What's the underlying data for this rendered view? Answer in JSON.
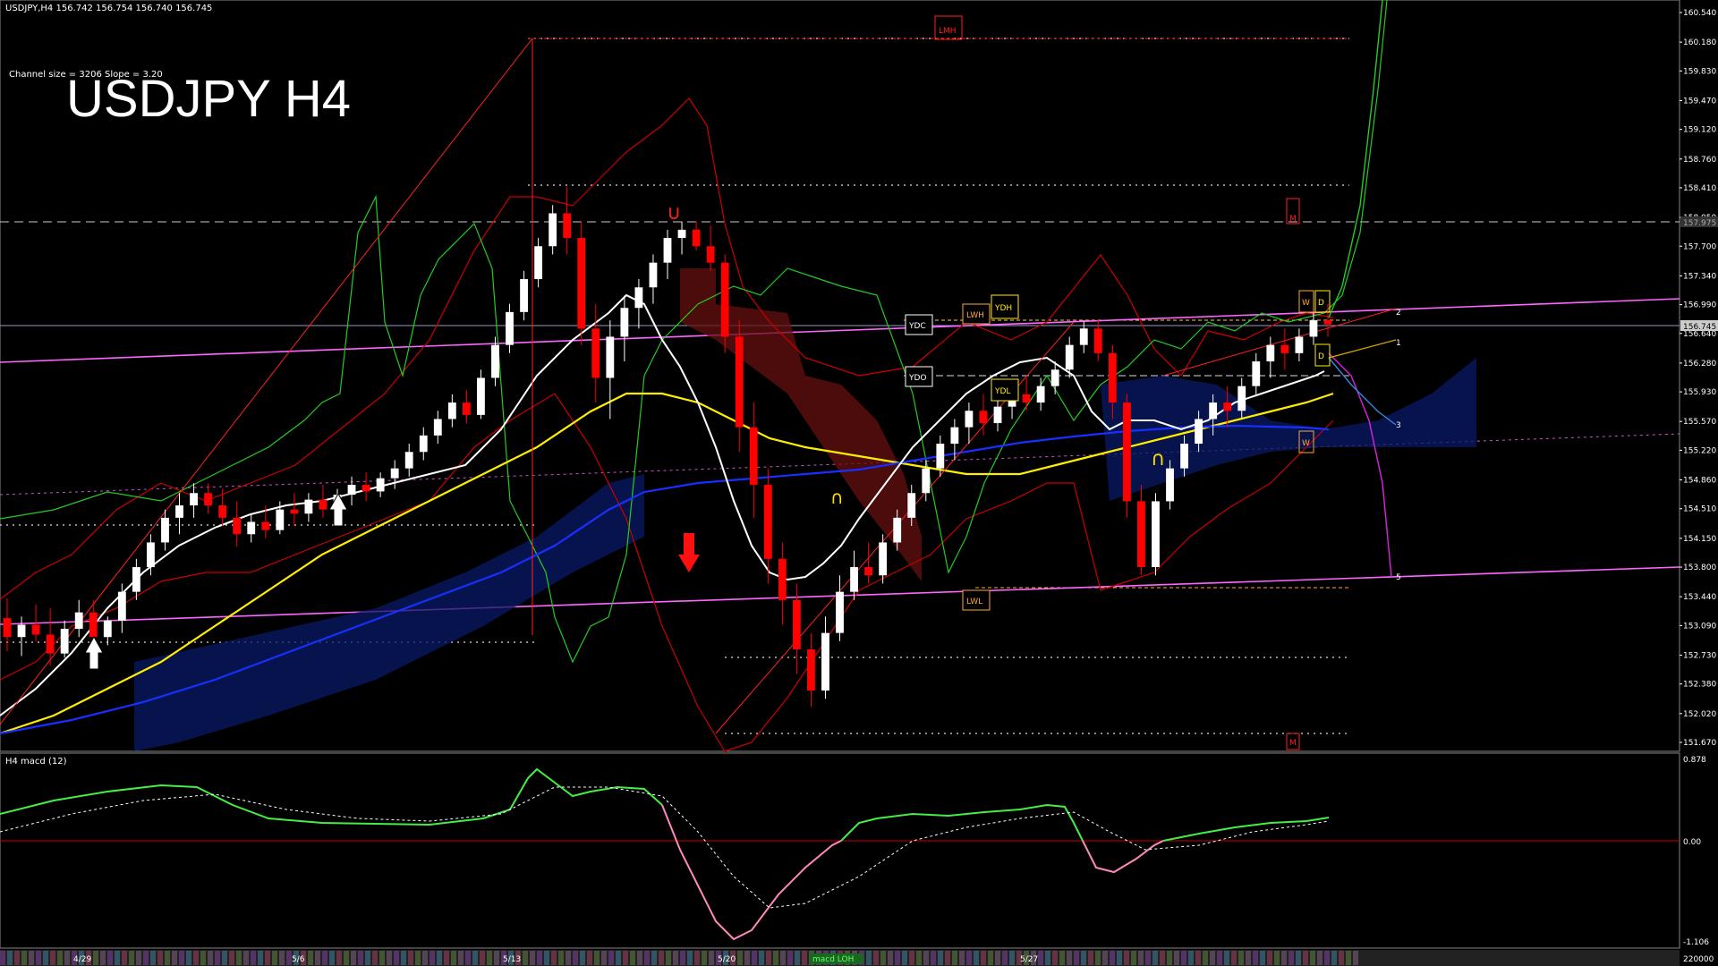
{
  "header": {
    "symbol_line": "USDJPY,H4  156.742 156.754 156.740 156.745",
    "channel_info": "Channel size = 3206 Slope = 3.20",
    "title": "USDJPY H4"
  },
  "macd": {
    "label": "H4  macd (12)",
    "axis_labels": [
      "0.878",
      "0.00",
      "-1.106"
    ],
    "bottom_value": "220000"
  },
  "price_axis": {
    "labels": [
      "160.540",
      "160.180",
      "159.830",
      "159.470",
      "159.120",
      "158.760",
      "158.410",
      "158.050",
      "157.700",
      "157.340",
      "156.990",
      "156.640",
      "156.280",
      "155.930",
      "155.570",
      "155.220",
      "154.860",
      "154.510",
      "154.150",
      "153.800",
      "153.440",
      "153.090",
      "152.730",
      "152.380",
      "152.020",
      "151.670"
    ],
    "current_price": "156.745",
    "upper_marker": "157.975"
  },
  "date_axis": {
    "labels": [
      "4/29",
      "5/6",
      "5/13",
      "5/20",
      "5/27"
    ],
    "scroll_label": "macd LOH"
  },
  "chart_tags": {
    "lmh": "LMH",
    "m_top": "M",
    "m_bottom": "M",
    "ydc": "YDC",
    "ydo": "YDO",
    "ydh": "YDH",
    "ydl": "YDL",
    "lwh": "LWH",
    "lwl": "LWL",
    "w_top": "W",
    "d_top": "D",
    "d_mid": "D",
    "w_low": "W"
  },
  "projection_labels": [
    "2",
    "1",
    "3",
    "5"
  ],
  "colors": {
    "background": "#000000",
    "bull_candle": "#ffffff",
    "bear_candle": "#ff0000",
    "ma_white": "#ffffff",
    "ma_yellow": "#ffee00",
    "ma_blue": "#1830ff",
    "bollinger": "#cc0000",
    "channel": "#ff66ff",
    "green_line": "#22cc22",
    "macd_green": "#44ee44",
    "macd_pink": "#ff88bb"
  },
  "chart_data": {
    "type": "candlestick",
    "ylim": [
      151.67,
      160.54
    ],
    "current_price": 156.745,
    "candles": [
      [
        153.18,
        153.42,
        152.78,
        152.95
      ],
      [
        152.95,
        153.2,
        152.72,
        153.1
      ],
      [
        153.1,
        153.35,
        152.9,
        152.98
      ],
      [
        152.98,
        153.3,
        152.6,
        152.75
      ],
      [
        152.75,
        153.15,
        152.7,
        153.05
      ],
      [
        153.05,
        153.4,
        152.95,
        153.25
      ],
      [
        153.25,
        153.4,
        152.85,
        152.95
      ],
      [
        152.95,
        153.2,
        152.85,
        153.15
      ],
      [
        153.15,
        153.6,
        153.0,
        153.5
      ],
      [
        153.5,
        153.9,
        153.4,
        153.8
      ],
      [
        153.8,
        154.2,
        153.7,
        154.1
      ],
      [
        154.1,
        154.5,
        154.0,
        154.4
      ],
      [
        154.4,
        154.7,
        154.2,
        154.55
      ],
      [
        154.55,
        154.82,
        154.4,
        154.7
      ],
      [
        154.7,
        154.82,
        154.45,
        154.55
      ],
      [
        154.55,
        154.75,
        154.3,
        154.4
      ],
      [
        154.4,
        154.6,
        154.05,
        154.2
      ],
      [
        154.2,
        154.45,
        154.1,
        154.35
      ],
      [
        154.35,
        154.55,
        154.15,
        154.25
      ],
      [
        154.25,
        154.6,
        154.2,
        154.5
      ],
      [
        154.5,
        154.7,
        154.3,
        154.45
      ],
      [
        154.45,
        154.7,
        154.35,
        154.62
      ],
      [
        154.62,
        154.8,
        154.4,
        154.5
      ],
      [
        154.5,
        154.75,
        154.4,
        154.68
      ],
      [
        154.68,
        154.9,
        154.55,
        154.8
      ],
      [
        154.8,
        154.95,
        154.6,
        154.72
      ],
      [
        154.72,
        154.95,
        154.65,
        154.88
      ],
      [
        154.88,
        155.1,
        154.75,
        155.0
      ],
      [
        155.0,
        155.3,
        154.9,
        155.2
      ],
      [
        155.2,
        155.5,
        155.1,
        155.4
      ],
      [
        155.4,
        155.7,
        155.3,
        155.6
      ],
      [
        155.6,
        155.9,
        155.5,
        155.8
      ],
      [
        155.8,
        155.95,
        155.55,
        155.65
      ],
      [
        155.65,
        156.2,
        155.6,
        156.1
      ],
      [
        156.1,
        156.6,
        156.0,
        156.5
      ],
      [
        156.5,
        157.0,
        156.4,
        156.9
      ],
      [
        156.9,
        157.4,
        156.8,
        157.3
      ],
      [
        157.3,
        157.8,
        157.2,
        157.7
      ],
      [
        157.7,
        158.2,
        157.6,
        158.1
      ],
      [
        158.1,
        158.42,
        157.6,
        157.8
      ],
      [
        157.8,
        158.0,
        156.5,
        156.7
      ],
      [
        156.7,
        157.0,
        155.8,
        156.1
      ],
      [
        156.1,
        156.8,
        155.6,
        156.6
      ],
      [
        156.6,
        157.1,
        156.3,
        156.95
      ],
      [
        156.95,
        157.3,
        156.7,
        157.2
      ],
      [
        157.2,
        157.6,
        157.0,
        157.5
      ],
      [
        157.5,
        157.9,
        157.3,
        157.8
      ],
      [
        157.8,
        158.0,
        157.6,
        157.9
      ],
      [
        157.9,
        158.0,
        157.65,
        157.7
      ],
      [
        157.7,
        157.95,
        157.4,
        157.5
      ],
      [
        157.5,
        157.6,
        156.4,
        156.6
      ],
      [
        156.6,
        156.8,
        155.2,
        155.5
      ],
      [
        155.5,
        155.8,
        154.4,
        154.8
      ],
      [
        154.8,
        155.0,
        153.6,
        153.9
      ],
      [
        153.9,
        154.1,
        153.1,
        153.4
      ],
      [
        153.4,
        153.6,
        152.5,
        152.8
      ],
      [
        152.8,
        153.0,
        152.1,
        152.3
      ],
      [
        152.3,
        153.2,
        152.2,
        153.0
      ],
      [
        153.0,
        153.7,
        152.9,
        153.5
      ],
      [
        153.5,
        154.0,
        153.4,
        153.8
      ],
      [
        153.8,
        154.1,
        153.6,
        153.7
      ],
      [
        153.7,
        154.2,
        153.6,
        154.1
      ],
      [
        154.1,
        154.5,
        154.0,
        154.4
      ],
      [
        154.4,
        154.8,
        154.3,
        154.7
      ],
      [
        154.7,
        155.1,
        154.6,
        155.0
      ],
      [
        155.0,
        155.4,
        154.9,
        155.3
      ],
      [
        155.3,
        155.6,
        155.1,
        155.5
      ],
      [
        155.5,
        155.8,
        155.3,
        155.7
      ],
      [
        155.7,
        155.9,
        155.4,
        155.55
      ],
      [
        155.55,
        155.85,
        155.45,
        155.75
      ],
      [
        155.75,
        156.0,
        155.6,
        155.9
      ],
      [
        155.9,
        156.1,
        155.7,
        155.8
      ],
      [
        155.8,
        156.1,
        155.7,
        156.0
      ],
      [
        156.0,
        156.3,
        155.9,
        156.2
      ],
      [
        156.2,
        156.6,
        156.1,
        156.5
      ],
      [
        156.5,
        156.8,
        156.4,
        156.7
      ],
      [
        156.7,
        156.8,
        156.3,
        156.4
      ],
      [
        156.4,
        156.5,
        155.6,
        155.8
      ],
      [
        155.8,
        155.9,
        154.4,
        154.6
      ],
      [
        154.6,
        154.8,
        153.7,
        153.8
      ],
      [
        153.8,
        154.7,
        153.7,
        154.6
      ],
      [
        154.6,
        155.1,
        154.5,
        155.0
      ],
      [
        155.0,
        155.4,
        154.9,
        155.3
      ],
      [
        155.3,
        155.7,
        155.2,
        155.6
      ],
      [
        155.6,
        155.9,
        155.4,
        155.8
      ],
      [
        155.8,
        156.0,
        155.5,
        155.7
      ],
      [
        155.7,
        156.1,
        155.6,
        156.0
      ],
      [
        156.0,
        156.4,
        155.9,
        156.3
      ],
      [
        156.3,
        156.6,
        156.1,
        156.5
      ],
      [
        156.5,
        156.7,
        156.2,
        156.4
      ],
      [
        156.4,
        156.7,
        156.3,
        156.6
      ],
      [
        156.6,
        156.9,
        156.5,
        156.8
      ],
      [
        156.8,
        157.0,
        156.6,
        156.75
      ]
    ]
  }
}
